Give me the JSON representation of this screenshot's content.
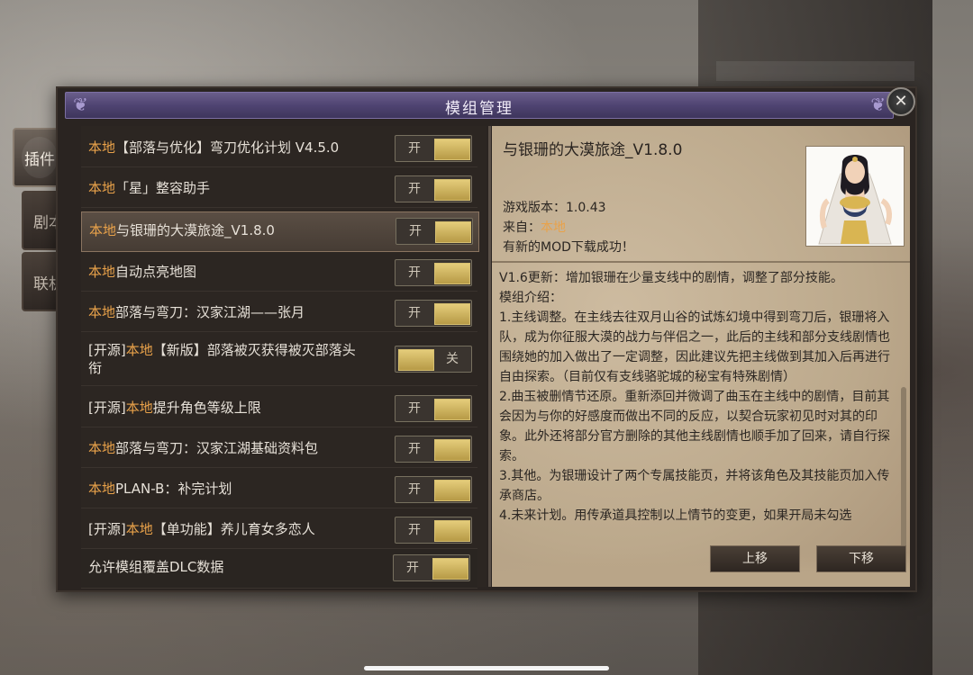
{
  "window": {
    "title": "模组管理"
  },
  "tabs": [
    {
      "label": "插件",
      "active": true
    },
    {
      "label": "剧本",
      "active": false
    },
    {
      "label": "联机",
      "active": false
    }
  ],
  "mods": [
    {
      "source": "本地",
      "prefix": "",
      "name": "【部落与优化】弯刀优化计划 V4.5.0",
      "toggle": "开",
      "enabled": true
    },
    {
      "source": "本地",
      "prefix": "",
      "name": "「星」整容助手",
      "toggle": "开",
      "enabled": true
    },
    {
      "source": "本地",
      "prefix": "",
      "name": "与银珊的大漠旅途_V1.8.0",
      "toggle": "开",
      "enabled": true,
      "selected": true
    },
    {
      "source": "本地",
      "prefix": "",
      "name": "自动点亮地图",
      "toggle": "开",
      "enabled": true
    },
    {
      "source": "本地",
      "prefix": "",
      "name": "部落与弯刀：汉家江湖——张月",
      "toggle": "开",
      "enabled": true
    },
    {
      "source": "本地",
      "prefix": "[开源]",
      "name": "【新版】部落被灭获得被灭部落头",
      "name_line2": "衔",
      "toggle": "关",
      "enabled": false
    },
    {
      "source": "本地",
      "prefix": "[开源]",
      "name": "提升角色等级上限",
      "toggle": "开",
      "enabled": true
    },
    {
      "source": "本地",
      "prefix": "",
      "name": "部落与弯刀：汉家江湖基础资料包",
      "toggle": "开",
      "enabled": true
    },
    {
      "source": "本地",
      "prefix": "",
      "name": "PLAN-B：补完计划",
      "toggle": "开",
      "enabled": true
    },
    {
      "source": "本地",
      "prefix": "[开源]",
      "name": "【单功能】养儿育女多恋人",
      "toggle": "开",
      "enabled": true
    }
  ],
  "dlc_override": {
    "label": "允许模组覆盖DLC数据",
    "toggle": "开",
    "enabled": true
  },
  "detail": {
    "title": "与银珊的大漠旅途_V1.8.0",
    "game_version_label": "游戏版本：",
    "game_version": "1.0.43",
    "source_label": "来自：",
    "source": "本地",
    "status": "有新的MOD下载成功！",
    "description": [
      "V1.6更新：增加银珊在少量支线中的剧情，调整了部分技能。",
      "模组介绍：",
      "1.主线调整。在主线去往双月山谷的试炼幻境中得到弯刀后，银珊将入队，成为你征服大漠的战力与伴侣之一，此后的主线和部分支线剧情也围绕她的加入做出了一定调整，因此建议先把主线做到其加入后再进行自由探索。（目前仅有支线骆驼城的秘宝有特殊剧情）",
      "2.曲玉被删情节还原。重新添回并微调了曲玉在主线中的剧情，目前其会因为与你的好感度而做出不同的反应，以契合玩家初见时对其的印象。此外还将部分官方删除的其他主线剧情也顺手加了回来，请自行探索。",
      "3.其他。为银珊设计了两个专属技能页，并将该角色及其技能页加入传承商店。",
      "4.未来计划。用传承道具控制以上情节的变更，如果开局未勾选"
    ],
    "move_up": "上移",
    "move_down": "下移"
  },
  "colors": {
    "accent": "#e9a24a",
    "knob": "#d9bf6a",
    "title_bar": "#4f4472"
  }
}
